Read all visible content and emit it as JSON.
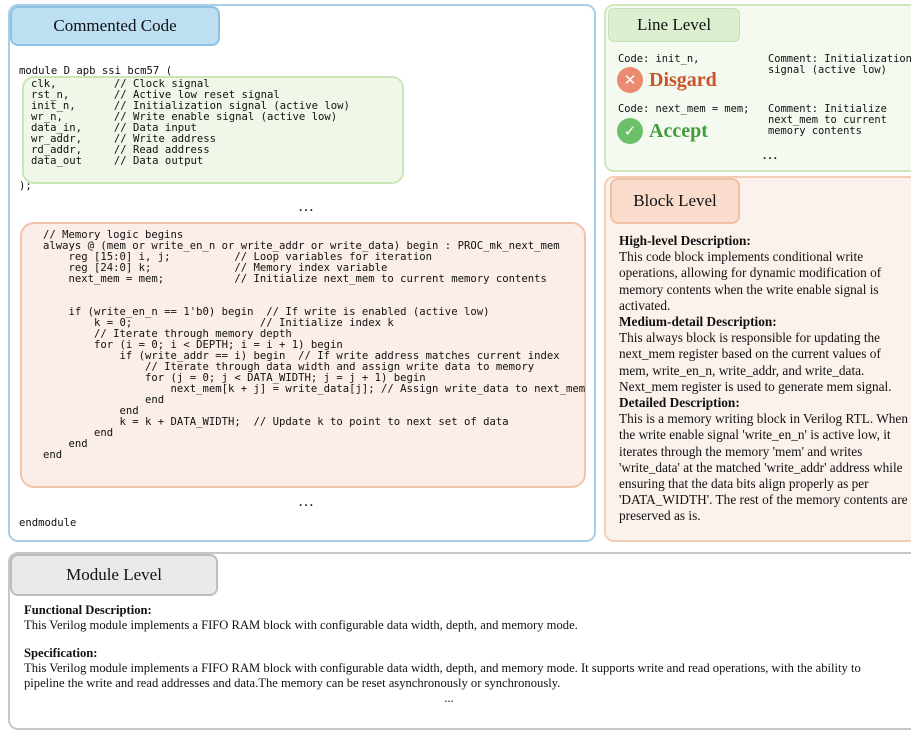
{
  "commented_code": {
    "tab_label": "Commented Code",
    "header_line": "module D_apb_ssi_bcm57 (",
    "ports": [
      "clk,         // Clock signal",
      "rst_n,       // Active low reset signal",
      "init_n,      // Initialization signal (active low)",
      "wr_n,        // Write enable signal (active low)",
      "data_in,     // Data input",
      "wr_addr,     // Write address",
      "rd_addr,     // Read address",
      "data_out     // Data output"
    ],
    "close_line": ");",
    "ellipsis_1": "…",
    "logic_lines": [
      "// Memory logic begins",
      "always @ (mem or write_en_n or write_addr or write_data) begin : PROC_mk_next_mem",
      "    reg [15:0] i, j;          // Loop variables for iteration",
      "    reg [24:0] k;             // Memory index variable",
      "    next_mem = mem;           // Initialize next_mem to current memory contents",
      "",
      "    if (write_en_n == 1'b0) begin  // If write is enabled (active low)",
      "        k = 0;                    // Initialize index k",
      "        // Iterate through memory depth",
      "        for (i = 0; i < DEPTH; i = i + 1) begin",
      "            if (write_addr == i) begin  // If write address matches current index",
      "                // Iterate through data width and assign write data to memory",
      "                for (j = 0; j < DATA_WIDTH; j = j + 1) begin",
      "                    next_mem[k + j] = write_data[j]; // Assign write_data to next_mem",
      "                end",
      "            end",
      "            k = k + DATA_WIDTH;  // Update k to point to next set of data",
      "        end",
      "    end",
      "end"
    ],
    "ellipsis_2": "…",
    "footer_line": "endmodule"
  },
  "line_level": {
    "tab_label": "Line Level",
    "items": [
      {
        "code": "Code: init_n,",
        "comment": "Comment: Initialization\nsignal (active low)",
        "verdict": "Disgard",
        "verdict_icon": "x-icon",
        "verdict_color": "#ea8a6e",
        "label_color": "#c9542a"
      },
      {
        "code": "Code: next_mem = mem;",
        "comment": "Comment: Initialize\nnext_mem to current\nmemory contents",
        "verdict": "Accept",
        "verdict_icon": "check-icon",
        "verdict_color": "#6cc06a",
        "label_color": "#3f9b3e"
      }
    ],
    "ellipsis": "…"
  },
  "block_level": {
    "tab_label": "Block Level",
    "high_title": "High-level Description:",
    "high_text": "This code block implements conditional write operations, allowing for dynamic modification of memory contents when the write enable signal is activated.",
    "medium_title": "Medium-detail Description:",
    "medium_text": "This always block is responsible for updating the next_mem register based on the current values of mem, write_en_n, write_addr, and write_data. Next_mem register is used to generate mem signal.",
    "detailed_title": "Detailed Description:",
    "detailed_text": "This is a memory writing block in Verilog RTL. When the write enable signal 'write_en_n' is active low, it iterates through the memory 'mem' and writes 'write_data' at the matched 'write_addr' address while ensuring that the data bits align properly as per 'DATA_WIDTH'. The rest of the memory contents are preserved as is."
  },
  "module_level": {
    "tab_label": "Module Level",
    "functional_title": "Functional Description:",
    "functional_text": "This Verilog module implements a FIFO RAM block with configurable data width, depth, and memory mode.",
    "spec_title": "Specification:",
    "spec_text": "This Verilog module implements a FIFO RAM block with configurable data width, depth, and memory mode. It supports write and read operations, with the ability to pipeline the write and read addresses and data.The memory can be reset asynchronously or synchronously.",
    "ellipsis": "..."
  },
  "colors": {
    "code_tab": "#bcdff2",
    "line_level": "#dcefd0",
    "block_level": "#f9dccb",
    "module_level": "#eaeaea"
  }
}
